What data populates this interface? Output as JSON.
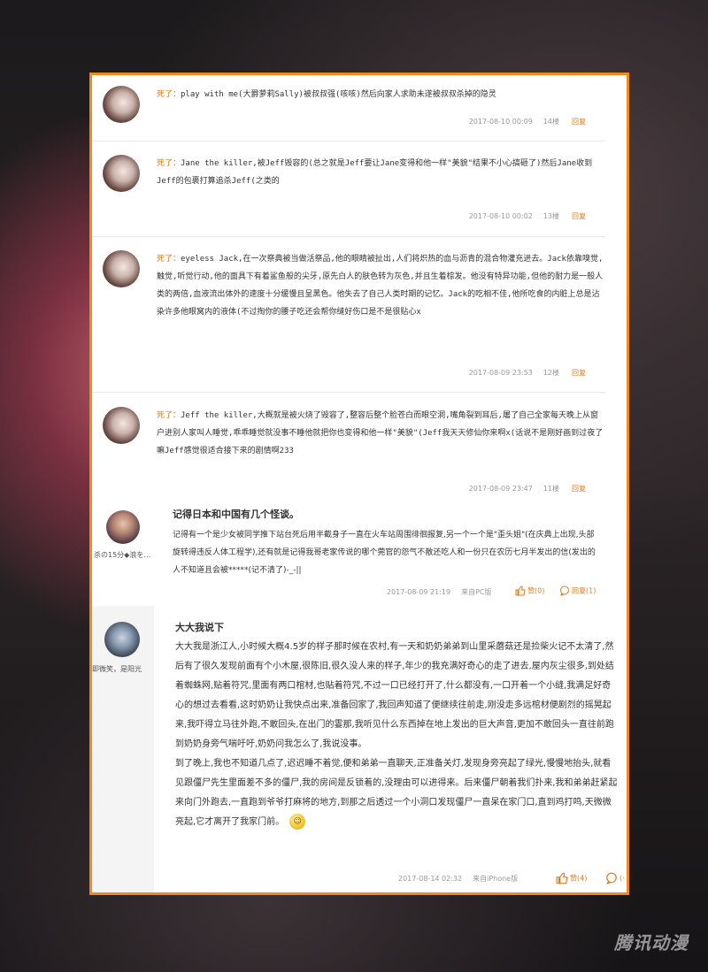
{
  "comments_short": [
    {
      "name": "死了：",
      "text": "play with me(大爵萝莉Sally)被叔叔强(咳咳)然后向家人求助未遂被叔叔杀掉的隐灵",
      "time": "2017-08-10 00:09",
      "floor": "14楼",
      "reply": "回复"
    },
    {
      "name": "死了：",
      "text": "Jane the killer,被Jeff毁容的(总之就是Jeff要让Jane变得和他一样\"美貌\"结果不小心搞砸了)然后Jane收到Jeff的包裹打算追杀Jeff(之类的",
      "time": "2017-08-10 00:02",
      "floor": "13楼",
      "reply": "回复"
    },
    {
      "name": "死了：",
      "text": "eyeless Jack,在一次祭典被当做活祭品,他的眼睛被扯出,人们将炽热的血与沥青的混合物灌充进去。Jack依靠嗅觉,触觉,听觉行动,他的面具下有着鲨鱼般的尖牙,原先白人的肤色转为灰色,并且生着棕发。他没有特异功能,但他的耐力是一般人类的两倍,血液流出体外的速度十分缓慢且呈黑色。他失去了自己人类时期的记忆。Jack的吃相不佳,他所吃食的内脏上总是沾染许多他眼窝内的液体(不过掏你的腰子吃还会帮你缝好伤口是不是很贴心x",
      "time": "2017-08-09 23:53",
      "floor": "12楼",
      "reply": "回复"
    },
    {
      "name": "死了：",
      "text": "Jeff the killer,大概就是被火烧了毁容了,整容后整个脸苍白而眼空洞,嘴角裂到耳后,屠了自己全家每天晚上从窗户进别人家叫人睡觉,乖乖睡觉就没事不睡他就把你也变得和他一样\"美貌\"(Jeff我天天修仙你来啊x(话说不是刚好画到过夜了嘛Jeff感觉很适合接下来的剧情啊233",
      "time": "2017-08-09 23:47",
      "floor": "11楼",
      "reply": "回复"
    }
  ],
  "comment_mid": {
    "user": "杀の15分◆浪を…",
    "title": "记得日本和中国有几个怪谈。",
    "body": "记得有一个是少女被同学推下站台死后用半截身子一直在火车站周围徘徊报复,另一个一个是\"歪头姐\"(在庆典上出现,头部旋转得违反人体工程学),还有就是记得我哥老家传说的哪个莞官的怨气不散还吃人和一份只在农历七月半发出的信(发出的人不知道且会被*****(记不清了)-_-||",
    "time": "2017-08-09 21:19",
    "source": "来自PC版",
    "likes": "赞(0)",
    "replies": "回复(1)"
  },
  "comment_long": {
    "user": "即微笑，是阳光",
    "title": "大大我说下",
    "para1": "大大我是浙江人,小时候大概4.5岁的样子那时候在农村,有一天和奶奶弟弟到山里采蘑菇还是捡柴火记不太清了,然后有了很久发现前面有个小木屋,很陈旧,很久没人来的样子,年少的我充满好奇心的走了进去,屋内灰尘很多,到处结着蜘蛛网,贴着符咒,里面有两口棺材,也贴着符咒,不过一口已经打开了,什么都没有,一口开着一个小缝,我满足好奇心的想过去看看,这时奶奶让我快点出来,准备回家了,我回声知道了便继续往前走,刚没走多远棺材便剧烈的摇晃起来,我吓得立马往外跑,不敢回头,在出门的霎那,我听见什么东西掉在地上发出的巨大声音,更加不敢回头一直往前跑到奶奶身旁气喘吁吁,奶奶问我怎么了,我说没事。",
    "para2": "到了晚上,我也不知道几点了,迟迟睡不着觉,便和弟弟一直聊天,正准备关灯,发现身旁亮起了绿光,慢慢地抬头,就看见跟僵尸先生里面差不多的僵尸,我的房间是反锁着的,没理由可以进得来。后来僵尸朝着我们扑来,我和弟弟赶紧起来向门外跑去,一直跑到爷爷打麻将的地方,到那之后透过一个小洞口发现僵尸一直呆在家门口,直到鸡打鸣,天微微亮起,它才离开了我家门前。",
    "time": "2017-08-14 02:32",
    "source": "来自iPhone版",
    "likes": "赞(4)",
    "more": "(·"
  },
  "watermark": "腾讯动漫",
  "colors": {
    "accent": "#f08a1c",
    "link": "#e07a1a"
  }
}
